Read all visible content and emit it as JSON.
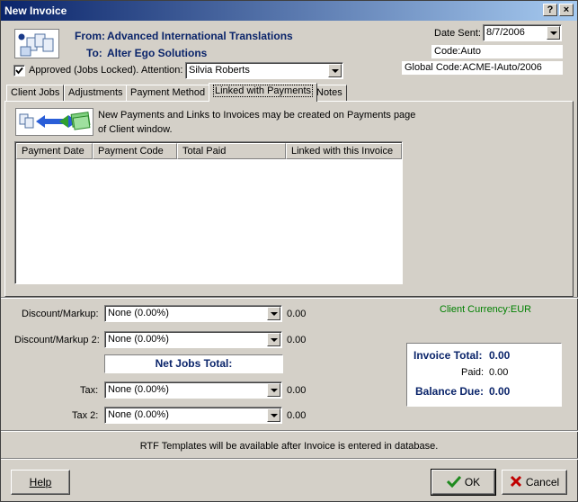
{
  "window": {
    "title": "New Invoice",
    "help_glyph": "?",
    "close_glyph": "×"
  },
  "header": {
    "from_label": "From:",
    "from_value": "Advanced International Translations",
    "to_label": "To:",
    "to_value": "Alter Ego Solutions",
    "approved_label": "Approved (Jobs Locked).",
    "approved_checked": true,
    "attention_label": "Attention:",
    "attention_value": "Silvia Roberts",
    "date_sent_label": "Date Sent:",
    "date_sent_value": "8/7/2006",
    "code_value": "Code:Auto",
    "global_code_value": "Global Code:ACME-IAuto/2006"
  },
  "tabs": [
    {
      "label": "Client Jobs",
      "active": false
    },
    {
      "label": "Adjustments",
      "active": false
    },
    {
      "label": "Payment Method",
      "active": false
    },
    {
      "label": "Linked with Payments",
      "active": true
    },
    {
      "label": "Notes",
      "active": false
    }
  ],
  "payments": {
    "info_line1": "New Payments and Links to Invoices may be created on Payments page",
    "info_line2": "of Client window.",
    "columns": [
      "Payment Date",
      "Payment Code",
      "Total Paid",
      "Linked with this Invoice"
    ],
    "rows": []
  },
  "adjust": {
    "discount_label": "Discount/Markup:",
    "discount_value": "None (0.00%)",
    "discount_amount": "0.00",
    "discount2_label": "Discount/Markup 2:",
    "discount2_value": "None (0.00%)",
    "discount2_amount": "0.00",
    "net_jobs_label": "Net Jobs Total:",
    "tax_label": "Tax:",
    "tax_value": "None (0.00%)",
    "tax_amount": "0.00",
    "tax2_label": "Tax 2:",
    "tax2_value": "None (0.00%)",
    "tax2_amount": "0.00"
  },
  "totals": {
    "currency": "Client Currency:EUR",
    "invoice_total_label": "Invoice Total:",
    "invoice_total_value": "0.00",
    "paid_label": "Paid:",
    "paid_value": "0.00",
    "balance_due_label": "Balance Due:",
    "balance_due_value": "0.00"
  },
  "footer": {
    "rtf_note": "RTF Templates will be available after Invoice is entered in database.",
    "help_label": "Help",
    "ok_label": "OK",
    "cancel_label": "Cancel"
  },
  "colors": {
    "title_start": "#0a246a",
    "title_end": "#a6caf0",
    "navy_text": "#0a246a",
    "currency_green": "#008000"
  },
  "icons": [
    "invoice-documents-icon",
    "payment-link-icon",
    "ok-check-icon",
    "cancel-x-icon",
    "checkbox-check-icon"
  ]
}
